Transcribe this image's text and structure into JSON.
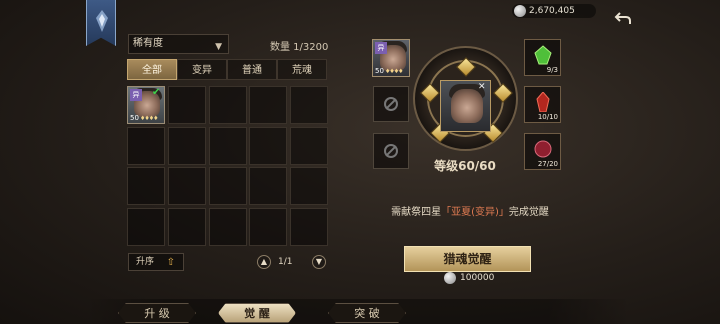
{
  "top": {
    "currency_value": "2,670,405",
    "currency_icon": "silver-coin-icon",
    "back_icon": "return-arrow-icon"
  },
  "filter": {
    "sort_label": "稀有度",
    "count_label": "数量 1/3200"
  },
  "tabs": [
    {
      "label": "全部",
      "active": true
    },
    {
      "label": "变异",
      "active": false
    },
    {
      "label": "普通",
      "active": false
    },
    {
      "label": "荒魂",
      "active": false
    }
  ],
  "inventory": [
    {
      "level": "50",
      "tag": "异",
      "selected": true
    }
  ],
  "controls": {
    "ascend_label": "升序",
    "page_label": "1/1"
  },
  "awaken": {
    "side_hero_level": "50",
    "side_hero_tag": "异",
    "level_label": "等级60/60",
    "materials": [
      {
        "name": "green-gem",
        "qty": "9/3",
        "color": "#4fbf3a"
      },
      {
        "name": "red-crystal",
        "qty": "10/10",
        "color": "#b3271f"
      },
      {
        "name": "crimson-orb",
        "qty": "27/20",
        "color": "#8f1f2f"
      }
    ],
    "desc_prefix": "需献祭四星",
    "desc_highlight": "「亚夏(变异)」",
    "desc_suffix": "完成觉醒",
    "button_label": "猎魂觉醒",
    "cost": "100000"
  },
  "nav": [
    {
      "label": "升 级",
      "active": false
    },
    {
      "label": "觉 醒",
      "active": true
    },
    {
      "label": "突 破",
      "active": false
    }
  ]
}
